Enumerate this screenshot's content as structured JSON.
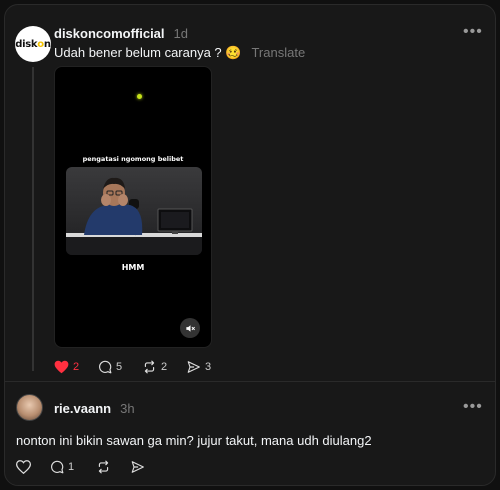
{
  "post": {
    "avatar_text_main": "disk",
    "avatar_text_dot": "o",
    "avatar_text_end": "n",
    "username": "diskoncomofficial",
    "time": "1d",
    "text": "Udah bener belum caranya ? 🥴",
    "translate": "Translate",
    "more": "•••",
    "video": {
      "caption_top": "pengatasi ngomong belibet",
      "caption_bottom": "HMM"
    },
    "actions": {
      "likes": "2",
      "replies": "5",
      "reposts": "2",
      "shares": "3"
    },
    "colors": {
      "like": "#ff3040"
    }
  },
  "reply": {
    "username": "rie.vaann",
    "time": "3h",
    "text": "nonton ini bikin sawan ga min? jujur takut, mana udh diulang2",
    "more": "•••",
    "actions": {
      "replies": "1"
    }
  }
}
